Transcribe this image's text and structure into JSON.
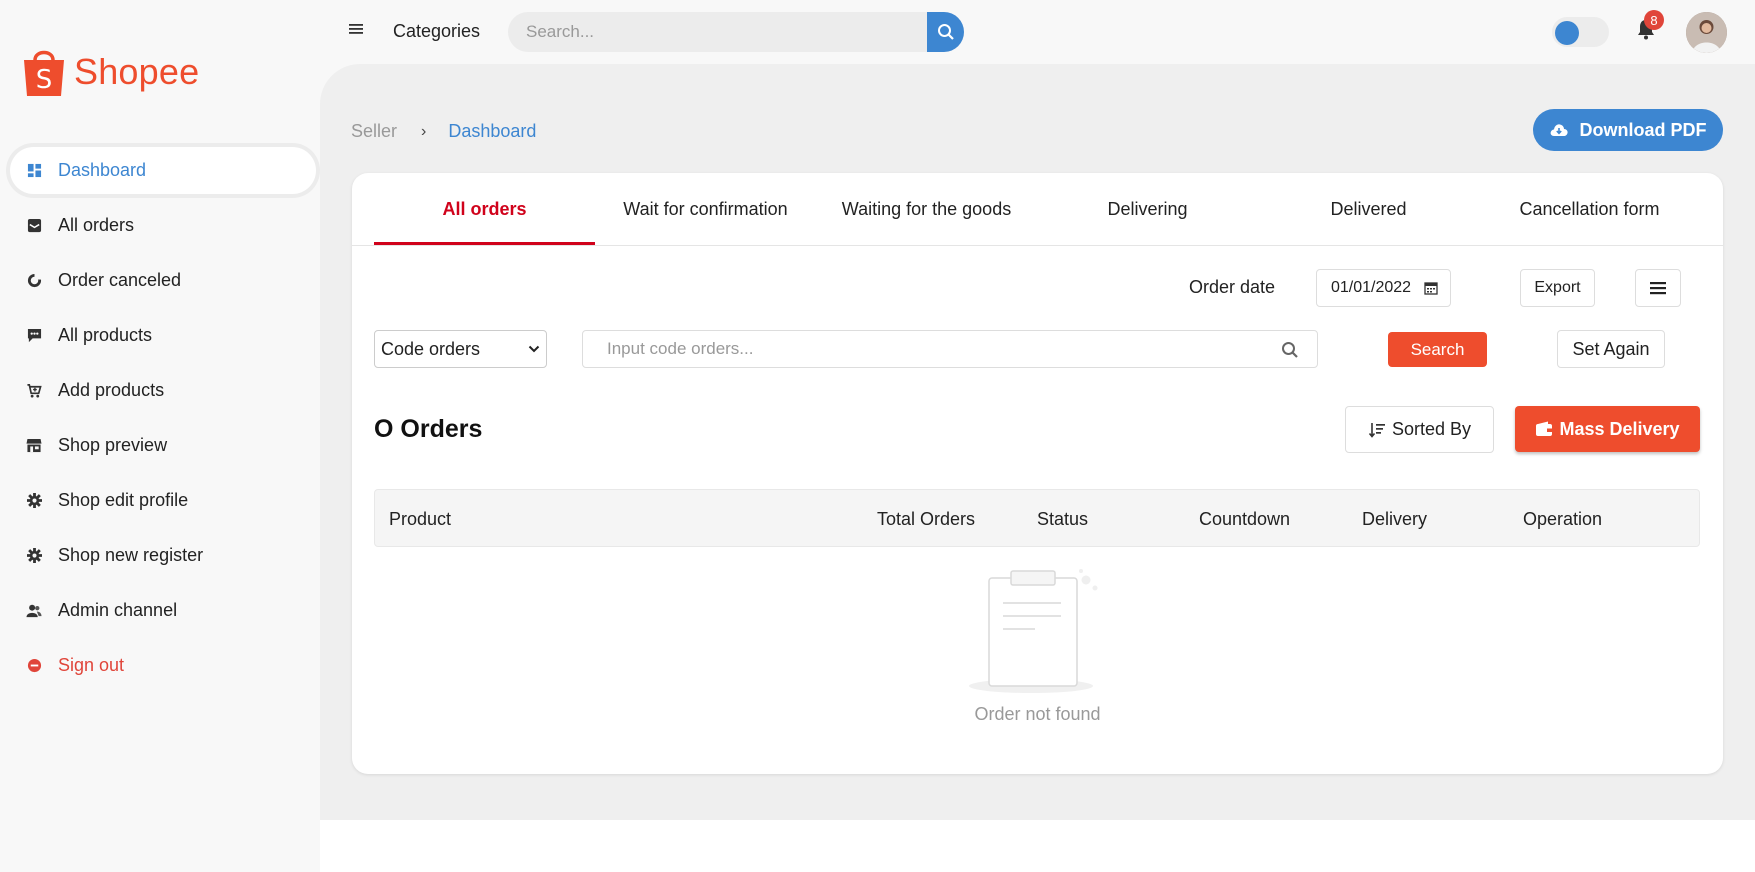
{
  "brand": {
    "name": "Shopee",
    "color": "#ee4d2d"
  },
  "sidebar": {
    "items": [
      {
        "label": "Dashboard",
        "icon": "dashboard-icon",
        "active": true
      },
      {
        "label": "All orders",
        "icon": "inbox-icon"
      },
      {
        "label": "Order canceled",
        "icon": "pie-chart-icon"
      },
      {
        "label": "All products",
        "icon": "comment-icon"
      },
      {
        "label": "Add products",
        "icon": "cart-plus-icon"
      },
      {
        "label": "Shop preview",
        "icon": "store-icon"
      },
      {
        "label": "Shop edit profile",
        "icon": "gear-icon"
      },
      {
        "label": "Shop new register",
        "icon": "gear-icon"
      },
      {
        "label": "Admin channel",
        "icon": "users-icon"
      },
      {
        "label": "Sign out",
        "icon": "minus-circle-icon"
      }
    ]
  },
  "topbar": {
    "categories_label": "Categories",
    "search_placeholder": "Search...",
    "notification_count": "8",
    "accent": "#3d86d1"
  },
  "breadcrumb": {
    "root": "Seller",
    "current": "Dashboard"
  },
  "download_label": "Download PDF",
  "tabs": [
    {
      "label": "All orders",
      "active": true
    },
    {
      "label": "Wait for confirmation"
    },
    {
      "label": "Waiting for the goods"
    },
    {
      "label": "Delivering"
    },
    {
      "label": "Delivered"
    },
    {
      "label": "Cancellation form"
    }
  ],
  "filters": {
    "order_date_label": "Order date",
    "order_date_value": "01/01/2022",
    "export_label": "Export",
    "code_select_value": "Code orders",
    "code_input_placeholder": "Input code orders...",
    "search_label": "Search",
    "set_again_label": "Set Again"
  },
  "orders": {
    "title": "O Orders",
    "sorted_label": "Sorted By",
    "mass_delivery_label": "Mass Delivery"
  },
  "table": {
    "columns": [
      "Product",
      "Total Orders",
      "Status",
      "Countdown",
      "Delivery",
      "Operation"
    ],
    "empty_text": "Order not found"
  }
}
